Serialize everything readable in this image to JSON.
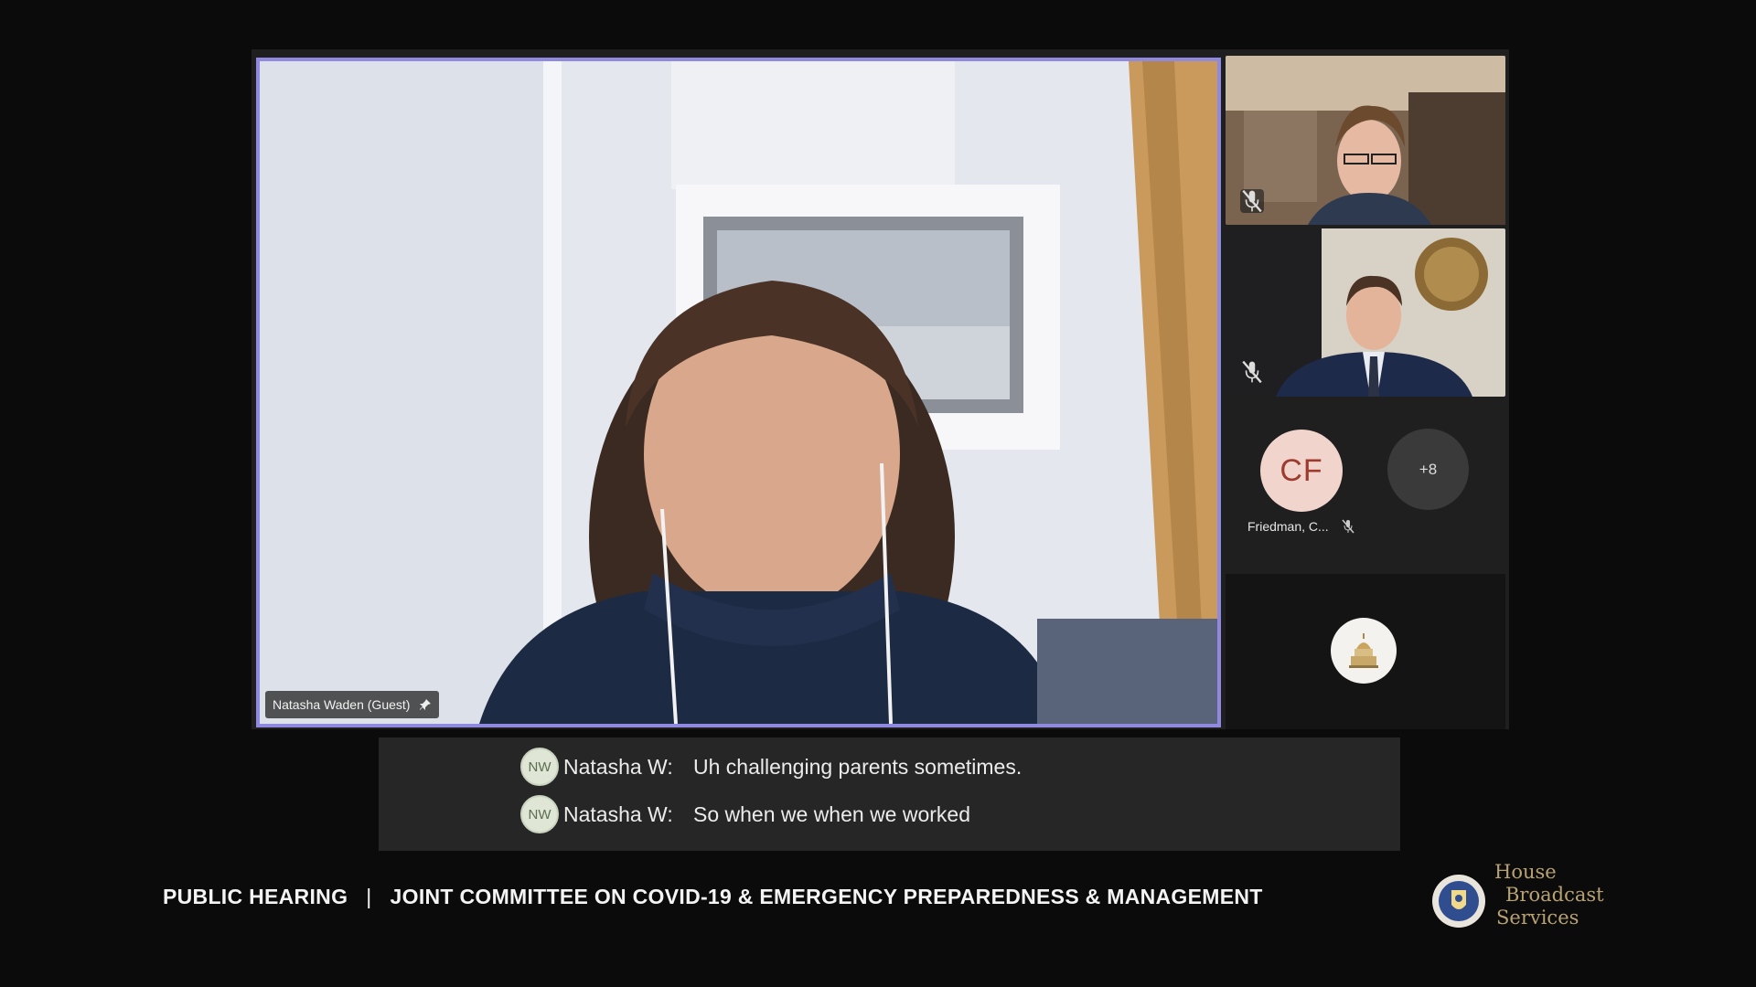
{
  "main_video": {
    "participant_label": "Natasha Waden (Guest)",
    "pin_icon": "pin-icon"
  },
  "side_videos": [
    {
      "mic_icon": "mic-off-icon"
    },
    {
      "mic_icon": "mic-off-icon"
    }
  ],
  "avatar": {
    "initials": "CF",
    "name": "Friedman, C...",
    "mic_icon": "mic-off-icon"
  },
  "overflow": {
    "label": "+8"
  },
  "captions": [
    {
      "initials": "NW",
      "speaker": "Natasha W:",
      "text": "Uh challenging parents sometimes."
    },
    {
      "initials": "NW",
      "speaker": "Natasha W:",
      "text": "So when we when we worked"
    }
  ],
  "lower_third": {
    "left": "PUBLIC HEARING",
    "separator": "|",
    "right": "JOINT COMMITTEE ON COVID-19 & EMERGENCY PREPAREDNESS & MANAGEMENT"
  },
  "branding": {
    "line1": "House",
    "line2": "Broadcast",
    "line3": "Services",
    "color": "#b8a274"
  },
  "colors": {
    "active_speaker_border": "#8f8ae0",
    "tile_background": "#1f1f1f",
    "caption_background": "#262626"
  }
}
